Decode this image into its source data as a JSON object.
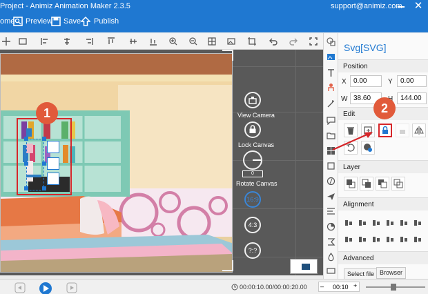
{
  "window": {
    "title": "Project - Animiz Animation Maker 2.3.5",
    "email": "support@animiz.com"
  },
  "toolbar": {
    "home_label": "ome",
    "preview_label": "Preview",
    "save_label": "Save",
    "publish_label": "Publish"
  },
  "stage_controls": {
    "view_camera": "View Camera",
    "lock_canvas": "Lock Canvas",
    "rotate_canvas": "Rotate Canvas",
    "rotate_value": "0",
    "ratio_169": "16:9",
    "ratio_43": "4:3",
    "ratio_custom": "?:?"
  },
  "panel": {
    "title": "Svg[SVG]",
    "position_header": "Position",
    "x_label": "X",
    "x_value": "0.00",
    "y_label": "Y",
    "y_value": "0.00",
    "w_label": "W",
    "w_value": "38.60",
    "h_label": "H",
    "h_value": "144.00",
    "edit_header": "Edit",
    "layer_header": "Layer",
    "alignment_header": "Alignment",
    "advanced_header": "Advanced",
    "select_file": "Select file",
    "browser": "Browser"
  },
  "annotations": {
    "badge1": "1",
    "badge2": "2"
  },
  "timeline": {
    "time": "00:00:10.00/00:00:20.00",
    "duration": "00:10"
  },
  "colors": {
    "accent": "#1f78d1",
    "annotation": "#e15a3a",
    "highlight_box": "#d6262a"
  },
  "icons": [
    "home-icon",
    "preview-icon",
    "save-icon",
    "publish-icon",
    "lock-icon",
    "camera-icon",
    "rotate-icon",
    "play-icon",
    "trash-icon"
  ]
}
